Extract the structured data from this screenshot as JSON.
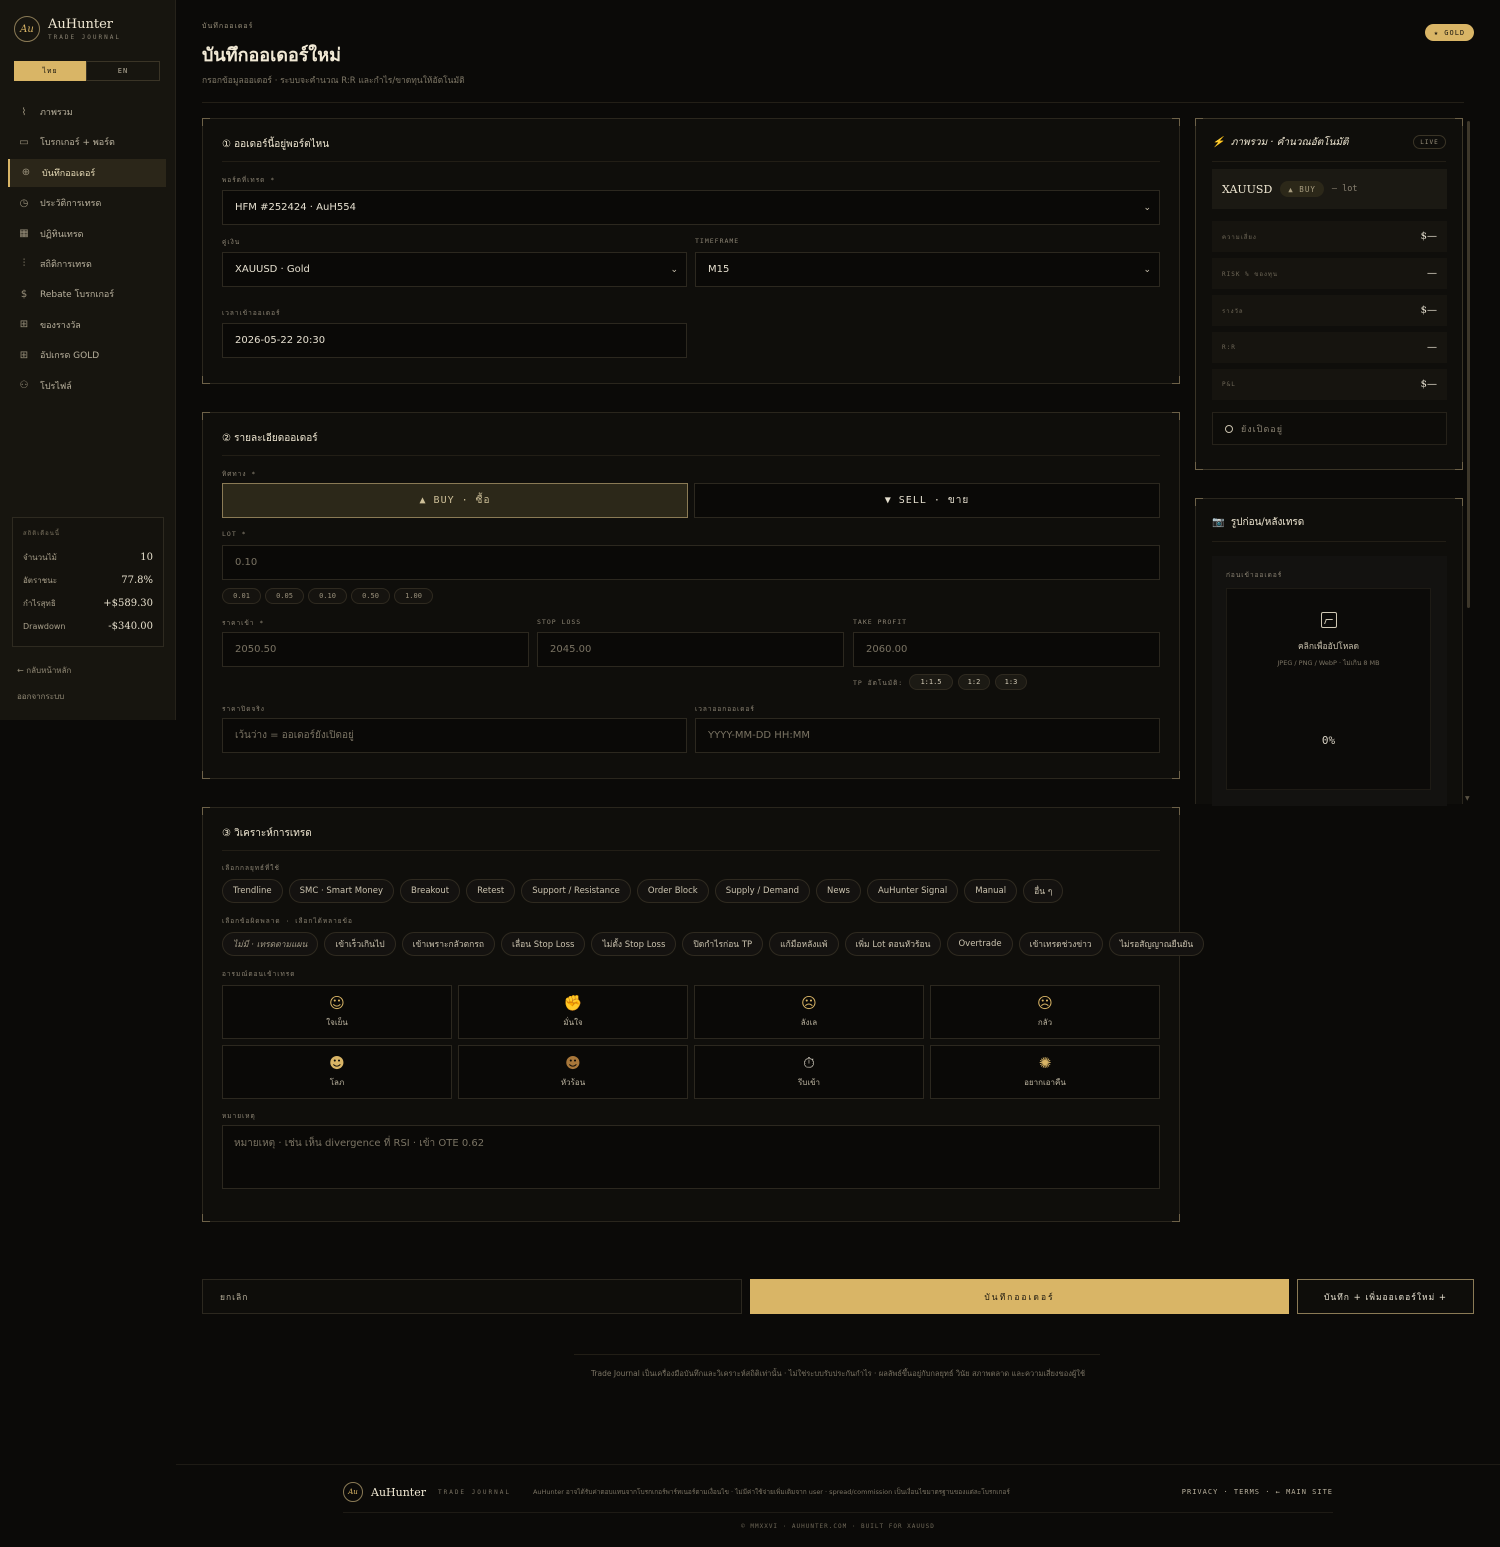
{
  "sidebar": {
    "brand_mark": "Au",
    "brand_name": "AuHunter",
    "brand_sub": "TRADE JOURNAL",
    "lang_th": "ไทย",
    "lang_en": "EN",
    "nav": [
      {
        "label": "ภาพรวม",
        "icon": "chart-line-icon"
      },
      {
        "label": "โบรกเกอร์ + พอร์ต",
        "icon": "briefcase-icon"
      },
      {
        "label": "บันทึกออเดอร์",
        "icon": "plus-circle-icon"
      },
      {
        "label": "ประวัติการเทรด",
        "icon": "clock-icon"
      },
      {
        "label": "ปฏิทินเทรด",
        "icon": "calendar-icon"
      },
      {
        "label": "สถิติการเทรด",
        "icon": "bar-chart-icon"
      },
      {
        "label": "Rebate โบรกเกอร์",
        "icon": "dollar-circle-icon"
      },
      {
        "label": "ของรางวัล",
        "icon": "gift-icon"
      },
      {
        "label": "อัปเกรด GOLD",
        "icon": "gift-box-icon"
      },
      {
        "label": "โปรไฟล์",
        "icon": "user-icon"
      }
    ],
    "stats": {
      "title": "สถิติเดือนนี้",
      "rows": [
        {
          "label": "จำนวนไม้",
          "value": "10"
        },
        {
          "label": "อัตราชนะ",
          "value": "77.8%"
        },
        {
          "label": "กำไรสุทธิ",
          "value": "+$589.30"
        },
        {
          "label": "Drawdown",
          "value": "-$340.00"
        }
      ]
    },
    "back": "← กลับหน้าหลัก",
    "logout": "ออกจากระบบ"
  },
  "header": {
    "crumb": "บันทึกออเดอร์",
    "title": "บันทึกออเดอร์ใหม่",
    "subtitle": "กรอกข้อมูลออเดอร์ · ระบบจะคำนวณ R:R และกำไร/ขาดทุนให้อัตโนมัติ",
    "badge": "★ GOLD"
  },
  "section1": {
    "title": "① ออเดอร์นี้อยู่พอร์ตไหน",
    "account_label": "พอร์ตที่เทรด *",
    "account_value": "HFM #252424 · AuH554",
    "pair_label": "คู่เงิน",
    "pair_value": "XAUUSD · Gold",
    "tf_label": "TIMEFRAME",
    "tf_value": "M15",
    "time_label": "เวลาเข้าออเดอร์",
    "time_value": "2026-05-22 20:30"
  },
  "section2": {
    "title": "② รายละเอียดออเดอร์",
    "dir_label": "ทิศทาง *",
    "buy": "▲ BUY · ซื้อ",
    "sell": "▼ SELL · ขาย",
    "lot_label": "LOT *",
    "lot_value": "0.10",
    "lot_presets": [
      "0.01",
      "0.05",
      "0.10",
      "0.50",
      "1.00"
    ],
    "entry_label": "ราคาเข้า *",
    "entry_value": "2050.50",
    "sl_label": "STOP LOSS",
    "sl_value": "2045.00",
    "tp_label": "TAKE PROFIT",
    "tp_value": "2060.00",
    "tp_auto_label": "TP อัตโนมัติ:",
    "tp_presets": [
      "1:1.5",
      "1:2",
      "1:3"
    ],
    "close_label": "ราคาปิดจริง",
    "close_placeholder": "เว้นว่าง = ออเดอร์ยังเปิดอยู่",
    "close_time_label": "เวลาออกออเดอร์",
    "close_time_placeholder": "YYYY-MM-DD HH:MM"
  },
  "section3": {
    "title": "③ วิเคราะห์การเทรด",
    "strategy_label": "เลือกกลยุทธ์ที่ใช้",
    "strategies": [
      "Trendline",
      "SMC · Smart Money",
      "Breakout",
      "Retest",
      "Support / Resistance",
      "Order Block",
      "Supply / Demand",
      "News",
      "AuHunter Signal",
      "Manual",
      "อื่น ๆ"
    ],
    "mistake_label": "เลือกข้อผิดพลาด · เลือกได้หลายข้อ",
    "mistakes": [
      "ไม่มี · เทรดตามแผน",
      "เข้าเร็วเกินไป",
      "เข้าเพราะกลัวตกรถ",
      "เลื่อน Stop Loss",
      "ไม่ตั้ง Stop Loss",
      "ปิดกำไรก่อน TP",
      "แก้มือหลังแพ้",
      "เพิ่ม Lot ตอนหัวร้อน",
      "Overtrade",
      "เข้าเทรดช่วงข่าว",
      "ไม่รอสัญญาณยืนยัน"
    ],
    "emotion_label": "อารมณ์ตอนเข้าเทรด",
    "emotions": [
      {
        "label": "ใจเย็น",
        "icon": "calm-face-icon",
        "glyph": "☺"
      },
      {
        "label": "มั่นใจ",
        "icon": "flexed-arm-icon",
        "glyph": "✊"
      },
      {
        "label": "ลังเล",
        "icon": "hesitant-face-icon",
        "glyph": "☹"
      },
      {
        "label": "กลัว",
        "icon": "fearful-face-icon",
        "glyph": "☹"
      },
      {
        "label": "โลภ",
        "icon": "greedy-face-icon",
        "glyph": "☻"
      },
      {
        "label": "หัวร้อน",
        "icon": "angry-face-icon",
        "glyph": "☻"
      },
      {
        "label": "รีบเข้า",
        "icon": "stopwatch-icon",
        "glyph": "⏱"
      },
      {
        "label": "อยากเอาคืน",
        "icon": "burst-icon",
        "glyph": "✺"
      }
    ],
    "note_label": "หมายเหตุ",
    "note_placeholder": "หมายเหตุ · เช่น เห็น divergence ที่ RSI · เข้า OTE 0.62"
  },
  "summary": {
    "title": "ภาพรวม · คำนวณอัตโนมัติ",
    "live": "LIVE",
    "symbol": "XAUUSD",
    "direction": "▲ BUY",
    "lot": "— lot",
    "metrics": [
      {
        "label": "ความเสี่ยง",
        "value": "$—"
      },
      {
        "label": "RISK % ของทุน",
        "value": "—"
      },
      {
        "label": "รางวัล",
        "value": "$—"
      },
      {
        "label": "R:R",
        "value": "—"
      },
      {
        "label": "P&L",
        "value": "$—"
      }
    ],
    "status": "ยังเปิดอยู่"
  },
  "upload": {
    "title": "รูปก่อน/หลังเทรด",
    "before_label": "ก่อนเข้าออเดอร์",
    "click": "คลิกเพื่ออัปโหลด",
    "formats": "JPEG / PNG / WebP · ไม่เกิน 8 MB",
    "progress_text": "0%"
  },
  "actions": {
    "cancel": "ยกเลิก",
    "save": "บันทึกออเดอร์",
    "save_new": "บันทึก + เพิ่มออเดอร์ใหม่ +"
  },
  "disclaimer": "Trade Journal เป็นเครื่องมือบันทึกและวิเคราะห์สถิติเท่านั้น · ไม่ใช่ระบบรับประกันกำไร · ผลลัพธ์ขึ้นอยู่กับกลยุทธ์ วินัย สภาพตลาด และความเสี่ยงของผู้ใช้",
  "footer": {
    "mark": "Au",
    "name": "AuHunter",
    "sub": "TRADE JOURNAL",
    "note": "AuHunter อาจได้รับค่าตอบแทนจากโบรกเกอร์พาร์ทเนอร์ตามเงื่อนไข · ไม่มีค่าใช้จ่ายเพิ่มเติมจาก user · spread/commission เป็นเงื่อนไขมาตรฐานของแต่ละโบรกเกอร์",
    "links": "PRIVACY · TERMS · ← MAIN SITE",
    "copyright": "© MMXXVI · AUHUNTER.COM · BUILT FOR XAUUSD"
  },
  "colors": {
    "accent": "#d9b566",
    "background": "#0b0a08",
    "panel": "#0f0e0b"
  }
}
